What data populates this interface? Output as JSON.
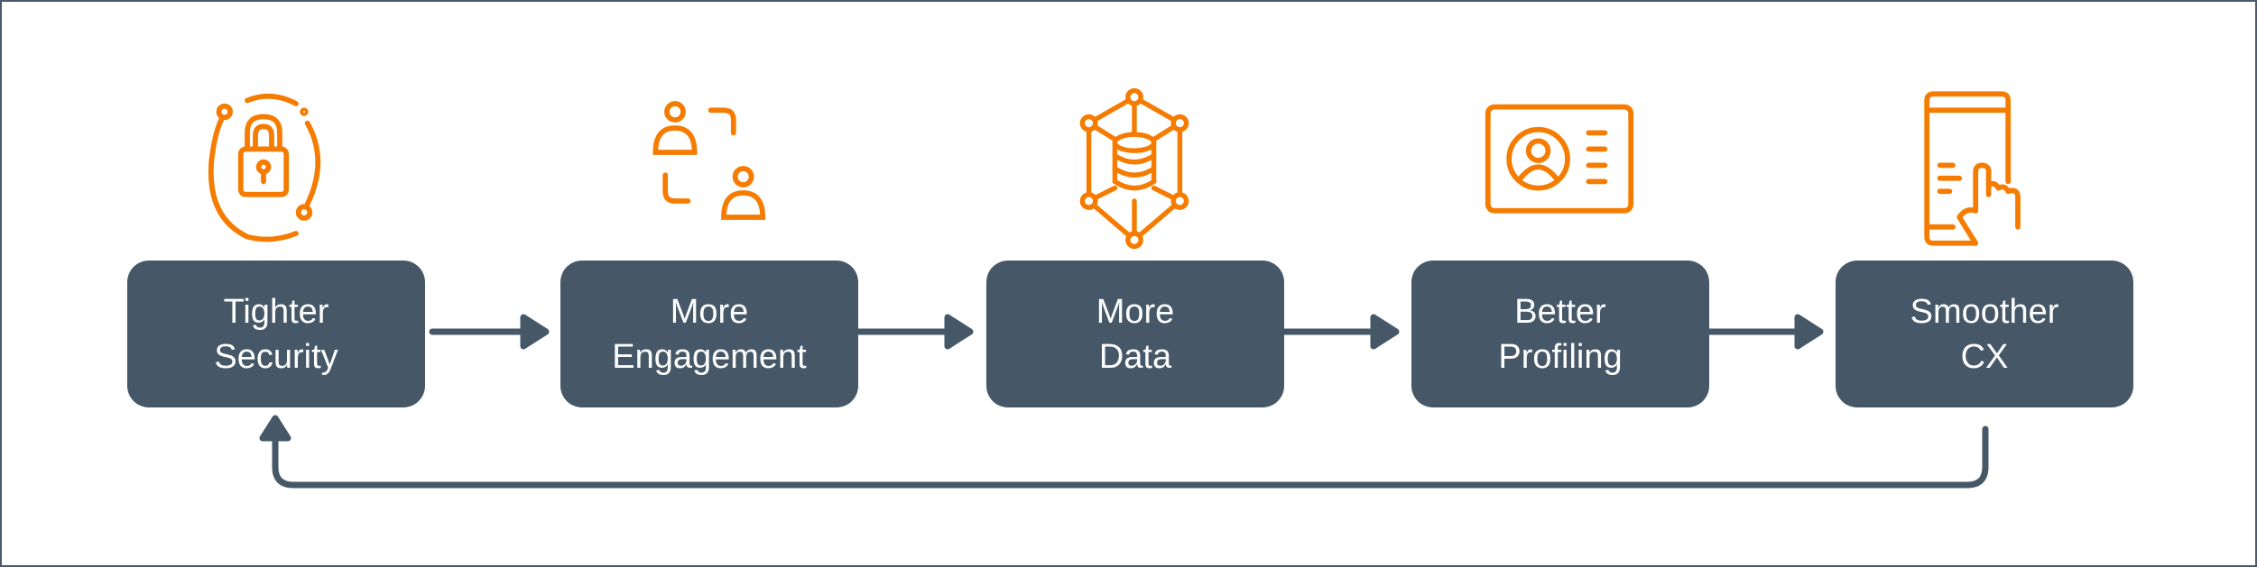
{
  "colors": {
    "box": "#465867",
    "accent": "#f57c00",
    "connector": "#465867"
  },
  "steps": [
    {
      "line1": "Tighter",
      "line2": "Security",
      "icon": "padlock-cycle-icon"
    },
    {
      "line1": "More",
      "line2": "Engagement",
      "icon": "people-exchange-icon"
    },
    {
      "line1": "More",
      "line2": "Data",
      "icon": "database-network-icon"
    },
    {
      "line1": "Better",
      "line2": "Profiling",
      "icon": "profile-card-icon"
    },
    {
      "line1": "Smoother",
      "line2": "CX",
      "icon": "phone-tap-icon"
    }
  ]
}
